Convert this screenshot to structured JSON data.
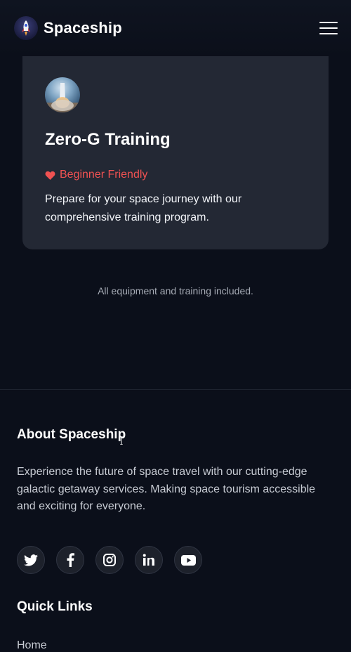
{
  "navbar": {
    "brand_name": "Spaceship",
    "logo_icon": "rocket-icon",
    "menu_icon": "hamburger-menu-icon"
  },
  "card": {
    "image_icon": "rocket-launch-image",
    "title": "Zero-G Training",
    "tag_icon": "heart-icon",
    "tag": "Beginner Friendly",
    "description": "Prepare for your space journey with our comprehensive training program."
  },
  "note": "All equipment and training included.",
  "footer": {
    "about_title": "About Spaceship",
    "about_text": "Experience the future of space travel with our cutting-edge galactic getaway services. Making space tourism accessible and exciting for everyone.",
    "socials": [
      "twitter-icon",
      "facebook-icon",
      "instagram-icon",
      "linkedin-icon",
      "youtube-icon"
    ],
    "quick_links_title": "Quick Links",
    "quick_links": [
      "Home"
    ]
  },
  "colors": {
    "background": "#0b0f1a",
    "card": "#232834",
    "accent_red": "#f05252",
    "muted_text": "#a6abb5"
  }
}
